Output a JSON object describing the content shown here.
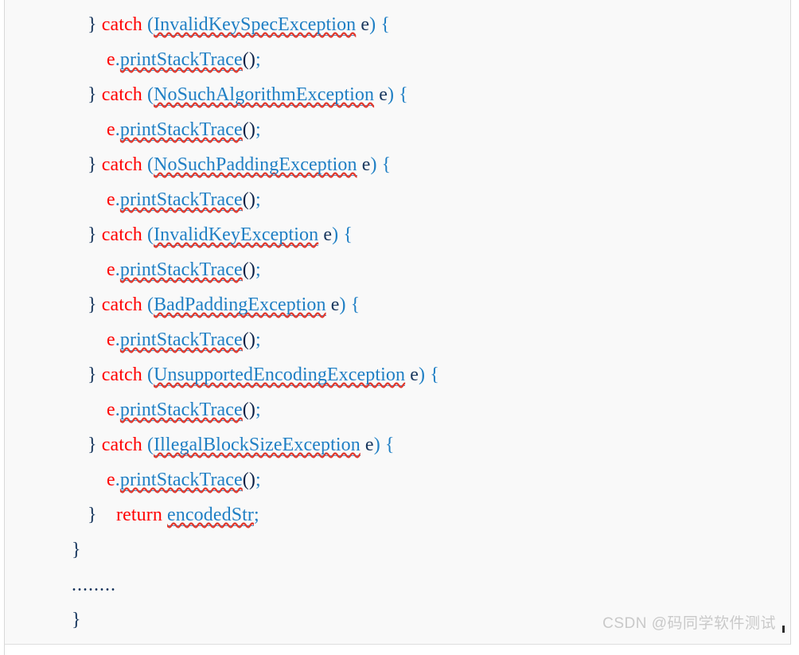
{
  "document": {
    "background_color": "#f9f9f9",
    "page_border_color": "#d8d8d8",
    "language": "java"
  },
  "theme": {
    "keyword_color": "#ff0000",
    "type_color": "#1f7fc4",
    "punctuation_color": "#1f7fc4",
    "plain_color": "#17365d",
    "spellcheck_underline_color": "#e03a2f",
    "link_underline_color": "#4a8fc4"
  },
  "code": {
    "lines": [
      {
        "indent": "catch",
        "tokens": [
          {
            "text": "}",
            "kind": "brace"
          },
          {
            "text": " ",
            "kind": "space"
          },
          {
            "text": "catch",
            "kind": "keyword"
          },
          {
            "text": " ",
            "kind": "space"
          },
          {
            "text": "(",
            "kind": "punct"
          },
          {
            "text": "InvalidKeySpecException",
            "kind": "type",
            "squiggle": true,
            "link": true
          },
          {
            "text": " ",
            "kind": "space"
          },
          {
            "text": "e",
            "kind": "var"
          },
          {
            "text": ")",
            "kind": "punct"
          },
          {
            "text": " ",
            "kind": "space"
          },
          {
            "text": "{",
            "kind": "punct"
          }
        ]
      },
      {
        "indent": "body",
        "tokens": [
          {
            "text": "e",
            "kind": "err"
          },
          {
            "text": ".",
            "kind": "punct"
          },
          {
            "text": "printStackTrace",
            "kind": "method",
            "squiggle": true,
            "link": true
          },
          {
            "text": "()",
            "kind": "paren"
          },
          {
            "text": ";",
            "kind": "punct"
          }
        ]
      },
      {
        "indent": "catch",
        "tokens": [
          {
            "text": "}",
            "kind": "brace"
          },
          {
            "text": " ",
            "kind": "space"
          },
          {
            "text": "catch",
            "kind": "keyword"
          },
          {
            "text": " ",
            "kind": "space"
          },
          {
            "text": "(",
            "kind": "punct"
          },
          {
            "text": "NoSuchAlgorithmException",
            "kind": "type",
            "squiggle": true,
            "link": true
          },
          {
            "text": " ",
            "kind": "space"
          },
          {
            "text": "e",
            "kind": "var"
          },
          {
            "text": ")",
            "kind": "punct"
          },
          {
            "text": " ",
            "kind": "space"
          },
          {
            "text": "{",
            "kind": "punct"
          }
        ]
      },
      {
        "indent": "body",
        "tokens": [
          {
            "text": "e",
            "kind": "err"
          },
          {
            "text": ".",
            "kind": "punct"
          },
          {
            "text": "printStackTrace",
            "kind": "method",
            "squiggle": true,
            "link": true
          },
          {
            "text": "()",
            "kind": "paren"
          },
          {
            "text": ";",
            "kind": "punct"
          }
        ]
      },
      {
        "indent": "catch",
        "tokens": [
          {
            "text": "}",
            "kind": "brace"
          },
          {
            "text": " ",
            "kind": "space"
          },
          {
            "text": "catch",
            "kind": "keyword"
          },
          {
            "text": " ",
            "kind": "space"
          },
          {
            "text": "(",
            "kind": "punct"
          },
          {
            "text": "NoSuchPaddingException",
            "kind": "type",
            "squiggle": true,
            "link": true
          },
          {
            "text": " ",
            "kind": "space"
          },
          {
            "text": "e",
            "kind": "var"
          },
          {
            "text": ")",
            "kind": "punct"
          },
          {
            "text": " ",
            "kind": "space"
          },
          {
            "text": "{",
            "kind": "punct"
          }
        ]
      },
      {
        "indent": "body",
        "tokens": [
          {
            "text": "e",
            "kind": "err"
          },
          {
            "text": ".",
            "kind": "punct"
          },
          {
            "text": "printStackTrace",
            "kind": "method",
            "squiggle": true,
            "link": true
          },
          {
            "text": "()",
            "kind": "paren"
          },
          {
            "text": ";",
            "kind": "punct"
          }
        ]
      },
      {
        "indent": "catch",
        "tokens": [
          {
            "text": "}",
            "kind": "brace"
          },
          {
            "text": " ",
            "kind": "space"
          },
          {
            "text": "catch",
            "kind": "keyword"
          },
          {
            "text": " ",
            "kind": "space"
          },
          {
            "text": "(",
            "kind": "punct"
          },
          {
            "text": "InvalidKeyException",
            "kind": "type",
            "squiggle": true,
            "link": true
          },
          {
            "text": " ",
            "kind": "space"
          },
          {
            "text": "e",
            "kind": "var"
          },
          {
            "text": ")",
            "kind": "punct"
          },
          {
            "text": " ",
            "kind": "space"
          },
          {
            "text": "{",
            "kind": "punct"
          }
        ]
      },
      {
        "indent": "body",
        "tokens": [
          {
            "text": "e",
            "kind": "err"
          },
          {
            "text": ".",
            "kind": "punct"
          },
          {
            "text": "printStackTrace",
            "kind": "method",
            "squiggle": true,
            "link": true
          },
          {
            "text": "()",
            "kind": "paren"
          },
          {
            "text": ";",
            "kind": "punct"
          }
        ]
      },
      {
        "indent": "catch",
        "tokens": [
          {
            "text": "}",
            "kind": "brace"
          },
          {
            "text": " ",
            "kind": "space"
          },
          {
            "text": "catch",
            "kind": "keyword"
          },
          {
            "text": " ",
            "kind": "space"
          },
          {
            "text": "(",
            "kind": "punct"
          },
          {
            "text": "BadPaddingException",
            "kind": "type",
            "squiggle": true,
            "link": true
          },
          {
            "text": " ",
            "kind": "space"
          },
          {
            "text": "e",
            "kind": "var"
          },
          {
            "text": ")",
            "kind": "punct"
          },
          {
            "text": " ",
            "kind": "space"
          },
          {
            "text": "{",
            "kind": "punct"
          }
        ]
      },
      {
        "indent": "body",
        "tokens": [
          {
            "text": "e",
            "kind": "err"
          },
          {
            "text": ".",
            "kind": "punct"
          },
          {
            "text": "printStackTrace",
            "kind": "method",
            "squiggle": true,
            "link": true
          },
          {
            "text": "()",
            "kind": "paren"
          },
          {
            "text": ";",
            "kind": "punct"
          }
        ]
      },
      {
        "indent": "catch",
        "tokens": [
          {
            "text": "}",
            "kind": "brace"
          },
          {
            "text": " ",
            "kind": "space"
          },
          {
            "text": "catch",
            "kind": "keyword"
          },
          {
            "text": " ",
            "kind": "space"
          },
          {
            "text": "(",
            "kind": "punct"
          },
          {
            "text": "UnsupportedEncodingException",
            "kind": "type",
            "squiggle": true,
            "link": true
          },
          {
            "text": " ",
            "kind": "space"
          },
          {
            "text": "e",
            "kind": "var"
          },
          {
            "text": ")",
            "kind": "punct"
          },
          {
            "text": " ",
            "kind": "space"
          },
          {
            "text": "{",
            "kind": "punct"
          }
        ]
      },
      {
        "indent": "body",
        "tokens": [
          {
            "text": "e",
            "kind": "err"
          },
          {
            "text": ".",
            "kind": "punct"
          },
          {
            "text": "printStackTrace",
            "kind": "method",
            "squiggle": true,
            "link": true
          },
          {
            "text": "()",
            "kind": "paren"
          },
          {
            "text": ";",
            "kind": "punct"
          }
        ]
      },
      {
        "indent": "catch",
        "tokens": [
          {
            "text": "}",
            "kind": "brace"
          },
          {
            "text": " ",
            "kind": "space"
          },
          {
            "text": "catch",
            "kind": "keyword"
          },
          {
            "text": " ",
            "kind": "space"
          },
          {
            "text": "(",
            "kind": "punct"
          },
          {
            "text": "IllegalBlockSizeException",
            "kind": "type",
            "squiggle": true,
            "link": true
          },
          {
            "text": " ",
            "kind": "space"
          },
          {
            "text": "e",
            "kind": "var"
          },
          {
            "text": ")",
            "kind": "punct"
          },
          {
            "text": " ",
            "kind": "space"
          },
          {
            "text": "{",
            "kind": "punct"
          }
        ]
      },
      {
        "indent": "body",
        "tokens": [
          {
            "text": "e",
            "kind": "err"
          },
          {
            "text": ".",
            "kind": "punct"
          },
          {
            "text": "printStackTrace",
            "kind": "method",
            "squiggle": true,
            "link": true
          },
          {
            "text": "()",
            "kind": "paren"
          },
          {
            "text": ";",
            "kind": "punct"
          }
        ]
      },
      {
        "indent": "catch",
        "tokens": [
          {
            "text": "}",
            "kind": "brace"
          },
          {
            "text": "    ",
            "kind": "space"
          },
          {
            "text": "return",
            "kind": "keyword"
          },
          {
            "text": " ",
            "kind": "space"
          },
          {
            "text": "encodedStr",
            "kind": "type",
            "squiggle": true,
            "link": true
          },
          {
            "text": ";",
            "kind": "punct"
          }
        ]
      },
      {
        "indent": "outer",
        "tokens": [
          {
            "text": "}",
            "kind": "brace"
          }
        ]
      },
      {
        "indent": "outer",
        "tokens": [
          {
            "text": "........",
            "kind": "ellipsis"
          }
        ]
      },
      {
        "indent": "outer",
        "tokens": [
          {
            "text": "}",
            "kind": "brace"
          }
        ]
      }
    ]
  },
  "watermark": {
    "text": "CSDN @码同学软件测试"
  }
}
